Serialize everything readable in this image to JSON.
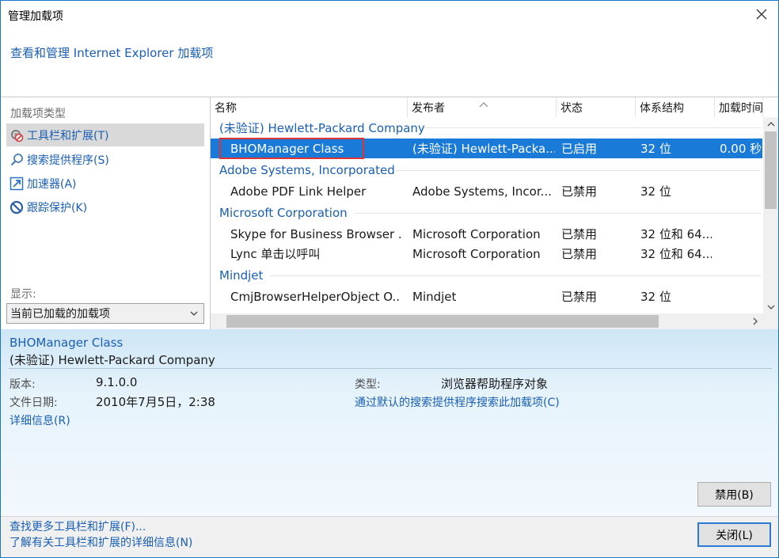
{
  "window": {
    "title": "管理加载项",
    "subtitle": "查看和管理 Internet Explorer 加载项"
  },
  "sidebar": {
    "group_label": "加载项类型",
    "items": [
      {
        "label": "工具栏和扩展(T)",
        "icon": "gear-plugin-icon",
        "selected": true
      },
      {
        "label": "搜索提供程序(S)",
        "icon": "search-icon",
        "selected": false
      },
      {
        "label": "加速器(A)",
        "icon": "accelerator-icon",
        "selected": false
      },
      {
        "label": "跟踪保护(K)",
        "icon": "prohibited-icon",
        "selected": false
      }
    ],
    "show_label": "显示:",
    "show_value": "当前已加载的加载项"
  },
  "list": {
    "columns": [
      "名称",
      "发布者",
      "状态",
      "体系结构",
      "加载时间"
    ],
    "groups": [
      {
        "name": "(未验证) Hewlett-Packard Company",
        "rows": [
          {
            "name": "BHOManager Class",
            "publisher": "(未验证) Hewlett-Packa...",
            "status": "已启用",
            "arch": "32 位",
            "load_time": "0.00 秒",
            "selected": true
          }
        ]
      },
      {
        "name": "Adobe Systems, Incorporated",
        "rows": [
          {
            "name": "Adobe PDF Link Helper",
            "publisher": "Adobe Systems, Incor...",
            "status": "已禁用",
            "arch": "32 位",
            "load_time": ""
          }
        ]
      },
      {
        "name": "Microsoft Corporation",
        "rows": [
          {
            "name": "Skype for Business Browser ...",
            "publisher": "Microsoft Corporation",
            "status": "已禁用",
            "arch": "32 位和 64...",
            "load_time": ""
          },
          {
            "name": "Lync 单击以呼叫",
            "publisher": "Microsoft Corporation",
            "status": "已禁用",
            "arch": "32 位和 64...",
            "load_time": ""
          }
        ]
      },
      {
        "name": "Mindjet",
        "rows": [
          {
            "name": "CmjBrowserHelperObject O...",
            "publisher": "Mindjet",
            "status": "已禁用",
            "arch": "32 位",
            "load_time": ""
          }
        ]
      }
    ]
  },
  "details": {
    "name": "BHOManager Class",
    "publisher": "(未验证) Hewlett-Packard Company",
    "version_label": "版本:",
    "version": "9.1.0.0",
    "date_label": "文件日期:",
    "date": "2010年7月5日，2:38",
    "more_info": "详细信息(R)",
    "type_label": "类型:",
    "type": "浏览器帮助程序对象",
    "search_link": "通过默认的搜索提供程序搜索此加载项(C)",
    "disable_button": "禁用(B)"
  },
  "footer": {
    "link1": "查找更多工具栏和扩展(F)...",
    "link2": "了解有关工具栏和扩展的详细信息(N)",
    "close_button": "关闭(L)"
  },
  "colors": {
    "accent": "#1a7ad8",
    "link": "#1a5fb4",
    "highlight_box": "#e03333"
  }
}
